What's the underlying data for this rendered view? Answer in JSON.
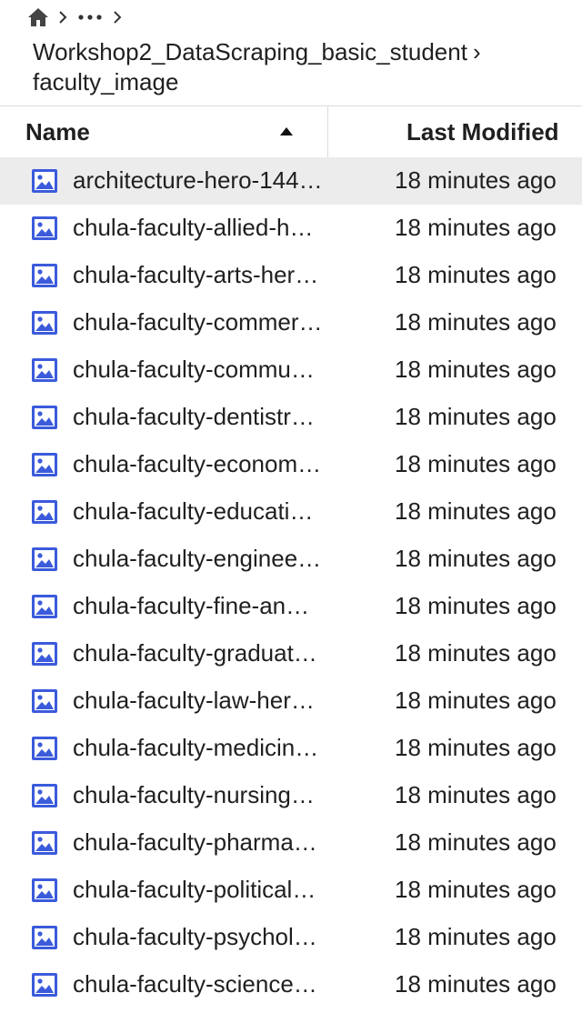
{
  "breadcrumb": {
    "home_icon": "home-icon",
    "more_label": "…",
    "path_line1": "Workshop2_DataScraping_basic_student",
    "path_chevron": "›",
    "path_line2": "faculty_image"
  },
  "columns": {
    "name_label": "Name",
    "name_sort": "ascending",
    "modified_label": "Last Modified"
  },
  "colors": {
    "icon_blue": "#3b5bdb",
    "selected_row": "#ececec"
  },
  "files": [
    {
      "name": "architecture-hero-144…",
      "modified": "18 minutes ago",
      "icon": "image-file-icon",
      "selected": true
    },
    {
      "name": "chula-faculty-allied-h…",
      "modified": "18 minutes ago",
      "icon": "image-file-icon"
    },
    {
      "name": "chula-faculty-arts-her…",
      "modified": "18 minutes ago",
      "icon": "image-file-icon"
    },
    {
      "name": "chula-faculty-commer…",
      "modified": "18 minutes ago",
      "icon": "image-file-icon"
    },
    {
      "name": "chula-faculty-commu…",
      "modified": "18 minutes ago",
      "icon": "image-file-icon"
    },
    {
      "name": "chula-faculty-dentistr…",
      "modified": "18 minutes ago",
      "icon": "image-file-icon"
    },
    {
      "name": "chula-faculty-econom…",
      "modified": "18 minutes ago",
      "icon": "image-file-icon"
    },
    {
      "name": "chula-faculty-educati…",
      "modified": "18 minutes ago",
      "icon": "image-file-icon"
    },
    {
      "name": "chula-faculty-enginee…",
      "modified": "18 minutes ago",
      "icon": "image-file-icon"
    },
    {
      "name": "chula-faculty-fine-an…",
      "modified": "18 minutes ago",
      "icon": "image-file-icon"
    },
    {
      "name": "chula-faculty-graduat…",
      "modified": "18 minutes ago",
      "icon": "image-file-icon"
    },
    {
      "name": "chula-faculty-law-her…",
      "modified": "18 minutes ago",
      "icon": "image-file-icon"
    },
    {
      "name": "chula-faculty-medicin…",
      "modified": "18 minutes ago",
      "icon": "image-file-icon"
    },
    {
      "name": "chula-faculty-nursing…",
      "modified": "18 minutes ago",
      "icon": "image-file-icon"
    },
    {
      "name": "chula-faculty-pharma…",
      "modified": "18 minutes ago",
      "icon": "image-file-icon"
    },
    {
      "name": "chula-faculty-political…",
      "modified": "18 minutes ago",
      "icon": "image-file-icon"
    },
    {
      "name": "chula-faculty-psychol…",
      "modified": "18 minutes ago",
      "icon": "image-file-icon"
    },
    {
      "name": "chula-faculty-science…",
      "modified": "18 minutes ago",
      "icon": "image-file-icon"
    }
  ]
}
